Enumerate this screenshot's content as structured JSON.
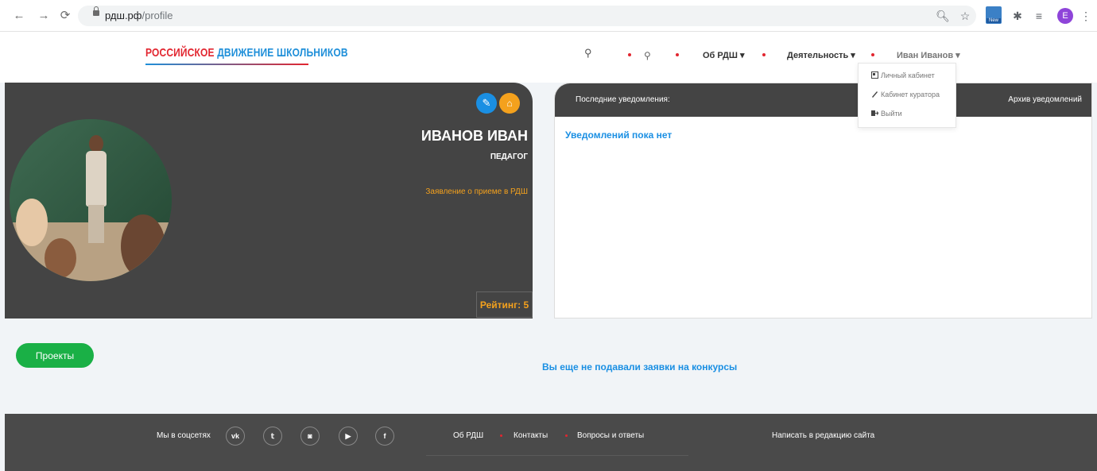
{
  "browser": {
    "url_domain": "рдш.рф",
    "url_path": "/profile"
  },
  "header": {
    "logo_red": "РОССИЙСКОЕ",
    "logo_blue_1": "ДВИЖЕНИЕ",
    "logo_blue_2": "ШКОЛЬНИКОВ",
    "nav_about": "Об РДШ ▾",
    "nav_activity": "Деятельность ▾",
    "nav_user": "Иван Иванов ▾"
  },
  "user_menu": {
    "items": [
      "Личный кабинет",
      "Кабинет куратора",
      "Выйти"
    ]
  },
  "profile": {
    "name": "ИВАНОВ ИВАН",
    "role": "ПЕДАГОГ",
    "application_link": "Заявление о приеме в РДШ",
    "rating": "Рейтинг: 5"
  },
  "notifications": {
    "title": "Последние уведомления:",
    "archive": "Архив уведомлений",
    "empty": "Уведомлений пока нет"
  },
  "projects": {
    "button": "Проекты",
    "empty": "Вы еще не подавали заявки на конкурсы"
  },
  "footer": {
    "social_label": "Мы в соцсетях",
    "social": [
      "vk",
      "twitter",
      "instagram",
      "youtube",
      "facebook"
    ],
    "links": [
      "Об РДШ",
      "Контакты",
      "Вопросы и ответы"
    ],
    "write": "Написать в редакцию сайта"
  },
  "colors": {
    "accent_blue": "#1a8fe3",
    "accent_orange": "#f4a11d",
    "accent_green": "#1ab046",
    "brand_red": "#e22630",
    "dark": "#444444"
  }
}
